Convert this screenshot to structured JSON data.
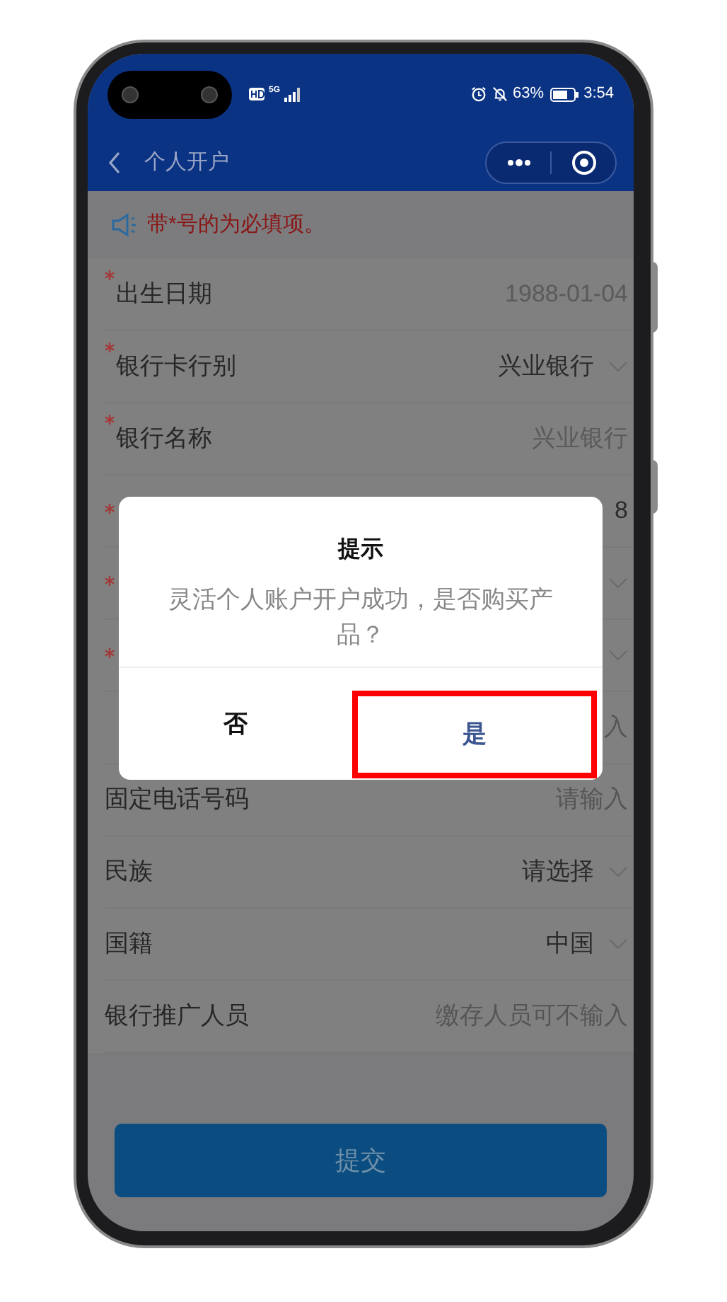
{
  "status_bar": {
    "network": "5G",
    "battery_percent": "63%",
    "time": "3:54"
  },
  "header": {
    "title": "个人开户"
  },
  "notice": {
    "text": "带*号的为必填项。"
  },
  "form_rows": [
    {
      "label": "出生日期",
      "required": true,
      "kind": "display",
      "value": "1988-01-04",
      "dropdown": false
    },
    {
      "label": "银行卡行别",
      "required": true,
      "kind": "select",
      "value": "兴业银行",
      "dropdown": true
    },
    {
      "label": "银行名称",
      "required": true,
      "kind": "display",
      "value": "兴业银行",
      "dropdown": false
    },
    {
      "required": true,
      "kind": "select",
      "value": "8",
      "dropdown": false
    },
    {
      "required": true,
      "dropdown": true
    },
    {
      "required": true,
      "dropdown": true
    },
    {
      "required": false,
      "kind": "input",
      "placeholder": "入",
      "dropdown": false
    },
    {
      "label": "固定电话号码",
      "required": false,
      "kind": "input",
      "placeholder": "请输入",
      "dropdown": false
    },
    {
      "label": "民族",
      "required": false,
      "kind": "select",
      "value": "请选择",
      "dropdown": true
    },
    {
      "label": "国籍",
      "required": false,
      "kind": "select",
      "value": "中国",
      "dropdown": true
    },
    {
      "label": "银行推广人员",
      "required": false,
      "kind": "input",
      "placeholder": "缴存人员可不输入",
      "dropdown": false
    }
  ],
  "submit_button": {
    "label": "提交"
  },
  "dialog": {
    "title": "提示",
    "message": "灵活个人账户开户成功，是否购买产品？",
    "buttons": [
      {
        "label": "否",
        "kind": "cancel",
        "highlighted": false
      },
      {
        "label": "是",
        "kind": "confirm",
        "highlighted": true
      }
    ]
  }
}
